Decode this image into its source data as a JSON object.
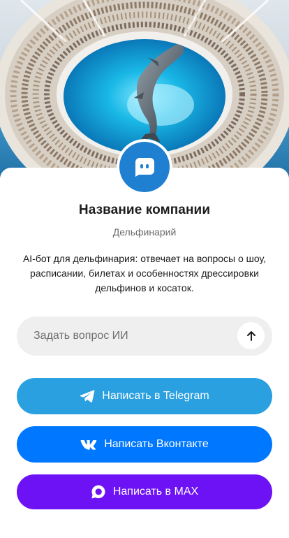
{
  "brand": {
    "company_name": "Название компании",
    "category": "Дельфинарий",
    "description": "AI-бот для дельфинария: отвечает на вопросы о шоу, расписании, билетах и особенностях дрессировки дельфинов и косаток.",
    "avatar_icon": "chat-bot-icon",
    "avatar_color": "#1f7fd0"
  },
  "ask": {
    "placeholder": "Задать вопрос ИИ",
    "value": "",
    "send_icon": "arrow-up-icon"
  },
  "buttons": {
    "telegram": {
      "label": "Написать в Telegram",
      "icon": "telegram-icon",
      "color": "#2aa0e0"
    },
    "vk": {
      "label": "Написать Вконтакте",
      "icon": "vk-icon",
      "color": "#0077ff"
    },
    "max": {
      "label": "Написать в MAX",
      "icon": "max-icon",
      "color": "#6d12f5"
    }
  }
}
